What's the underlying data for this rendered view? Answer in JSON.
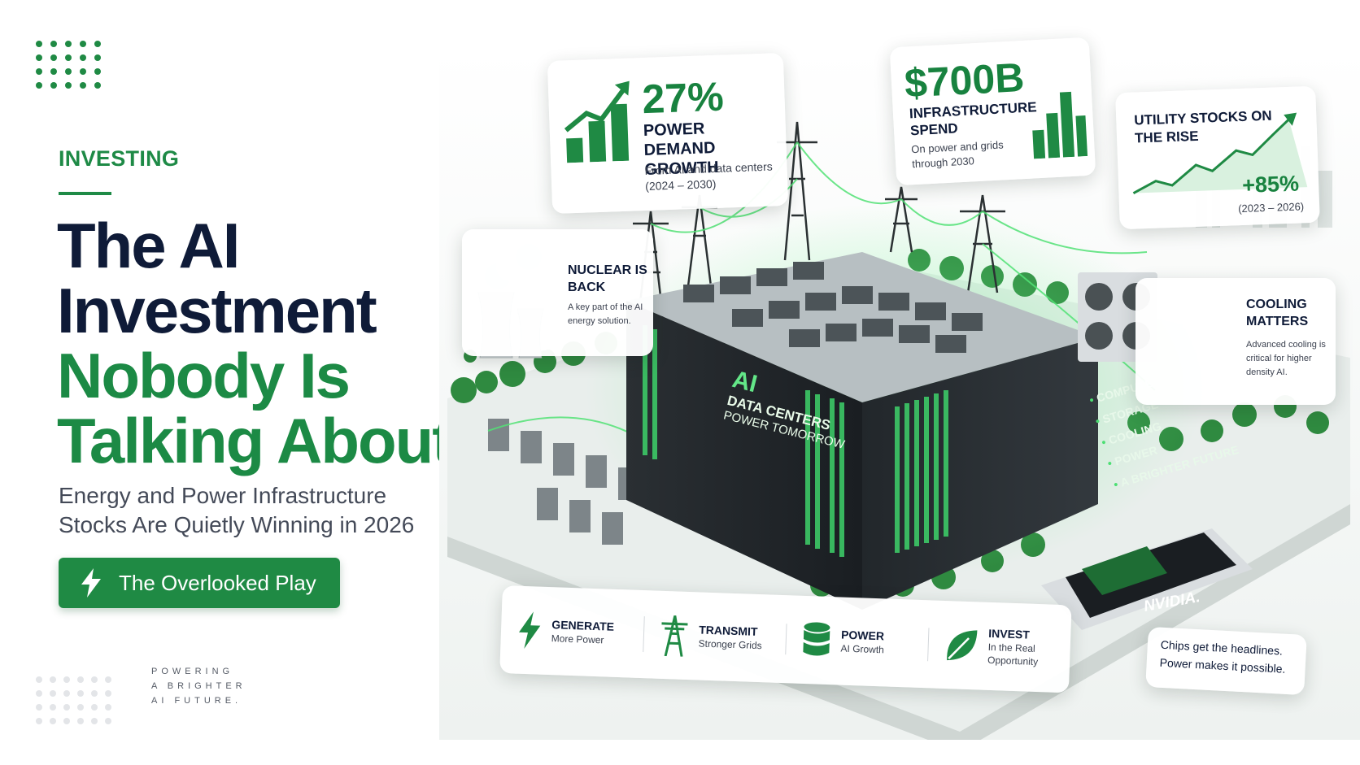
{
  "left": {
    "category": "INVESTING",
    "headline_dark": [
      "The AI",
      "Investment"
    ],
    "headline_green": [
      "Nobody Is",
      "Talking About"
    ],
    "subline": [
      "Energy and Power Infrastructure",
      "Stocks Are Quietly Winning in 2026"
    ],
    "cta_label": "The Overlooked Play",
    "tagline": [
      "POWERING",
      "A BRIGHTER",
      "AI FUTURE."
    ]
  },
  "cards": {
    "power_demand": {
      "value": "27%",
      "title": "POWER DEMAND GROWTH",
      "note_1": "From AI and data centers",
      "note_2": "(2024 – 2030)"
    },
    "infrastructure": {
      "value": "$700B",
      "title": "INFRASTRUCTURE SPEND",
      "note_1": "On power and grids",
      "note_2": "through 2030"
    },
    "utility": {
      "title": "UTILITY STOCKS ON THE RISE",
      "value": "+85%",
      "note": "(2023 – 2026)"
    },
    "nuclear": {
      "title": "NUCLEAR IS BACK",
      "note": "A key part of the AI energy solution."
    },
    "cooling": {
      "title": "COOLING MATTERS",
      "note": "Advanced cooling is critical for higher density AI."
    }
  },
  "building": {
    "facade_ai": "AI",
    "facade_line2": "DATA CENTERS",
    "facade_line3": "POWER TOMORROW",
    "bullets": [
      "COMPUTE",
      "STORAGE",
      "COOLING",
      "POWER",
      "A BRIGHTER FUTURE"
    ]
  },
  "pillars": [
    {
      "title": "GENERATE",
      "sub": "More Power"
    },
    {
      "title": "TRANSMIT",
      "sub": "Stronger Grids"
    },
    {
      "title": "POWER",
      "sub": "AI Growth"
    },
    {
      "title": "INVEST",
      "sub": "In the Real Opportunity"
    }
  ],
  "chip": {
    "logo": "NVIDIA.",
    "note": "Chips get the headlines. Power makes it possible."
  },
  "colors": {
    "accent": "#1f8a44",
    "navy": "#0f1b38",
    "glow": "#4cdf73"
  },
  "icons": [
    "lightning-icon",
    "transmission-tower-icon",
    "database-icon",
    "leaf-icon",
    "bar-chart-icon",
    "trend-line-icon",
    "nuclear-plant-icon",
    "cooling-fan-icon"
  ]
}
